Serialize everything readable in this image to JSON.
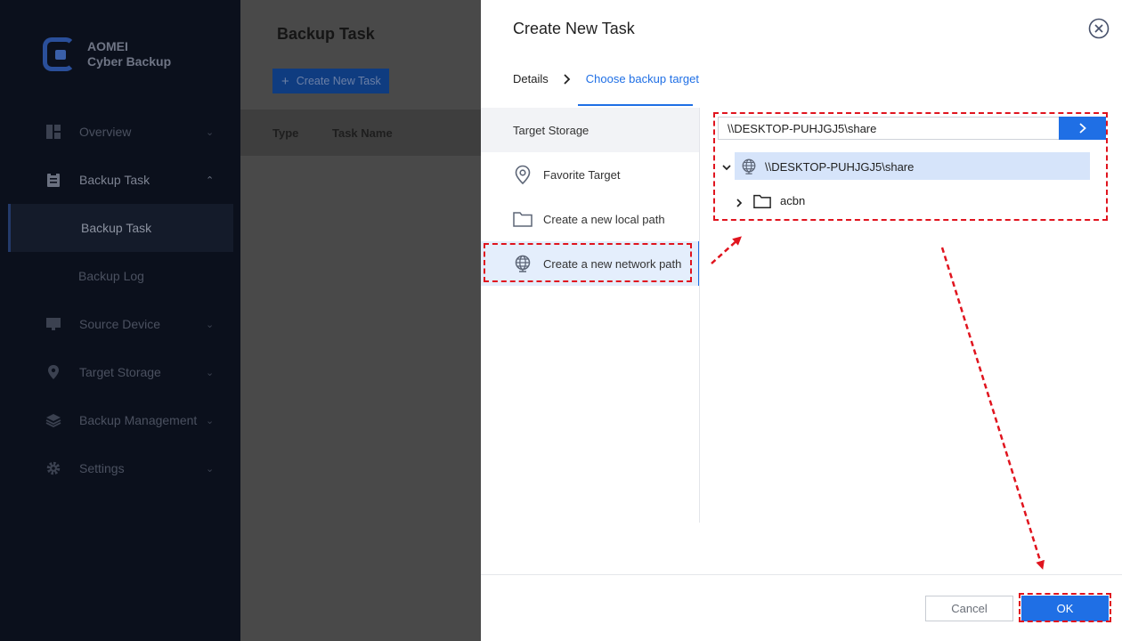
{
  "app": {
    "brand_line1": "AOMEI",
    "brand_line2": "Cyber Backup"
  },
  "sidebar": {
    "items": [
      {
        "label": "Overview",
        "icon": "overview-icon"
      },
      {
        "label": "Backup Task",
        "icon": "clipboard-icon",
        "expanded": true
      },
      {
        "label": "Backup Task",
        "sub": true,
        "active": true
      },
      {
        "label": "Backup Log",
        "sub": true
      },
      {
        "label": "Source Device",
        "icon": "monitor-icon"
      },
      {
        "label": "Target Storage",
        "icon": "location-pin-icon"
      },
      {
        "label": "Backup Management",
        "icon": "layers-icon"
      },
      {
        "label": "Settings",
        "icon": "gear-icon"
      }
    ]
  },
  "main": {
    "title": "Backup Task",
    "create_button": "Create New Task",
    "columns": [
      "Type",
      "Task Name"
    ]
  },
  "dialog": {
    "title": "Create New Task",
    "steps": [
      "Details",
      "Choose backup target"
    ],
    "target_storage_header": "Target Storage",
    "options": [
      {
        "label": "Favorite Target",
        "icon": "location-pin-icon"
      },
      {
        "label": "Create a new local path",
        "icon": "folder-icon"
      },
      {
        "label": "Create a new network path",
        "icon": "globe-icon",
        "selected": true
      }
    ],
    "path_value": "\\\\DESKTOP-PUHJGJ5\\share",
    "tree": {
      "root": "\\\\DESKTOP-PUHJGJ5\\share",
      "children": [
        "acbn"
      ]
    },
    "cancel_label": "Cancel",
    "ok_label": "OK"
  },
  "colors": {
    "accent": "#1f6fe5",
    "annotation": "#e0141e",
    "sidebar_bg": "#0b101c"
  }
}
